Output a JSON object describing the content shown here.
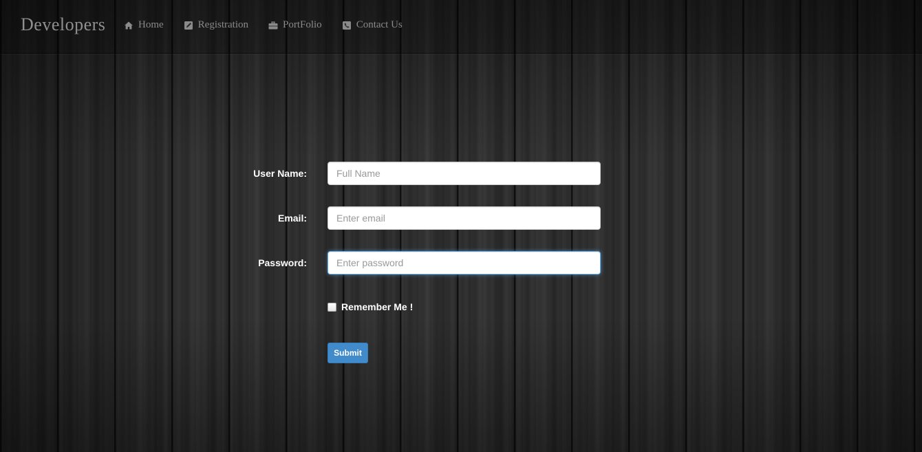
{
  "navbar": {
    "brand": "Developers",
    "items": [
      {
        "label": "Home",
        "icon": "home-icon"
      },
      {
        "label": "Registration",
        "icon": "edit-icon"
      },
      {
        "label": "PortFolio",
        "icon": "briefcase-icon"
      },
      {
        "label": "Contact Us",
        "icon": "phone-icon"
      }
    ]
  },
  "form": {
    "username": {
      "label": "User Name:",
      "placeholder": "Full Name",
      "value": ""
    },
    "email": {
      "label": "Email:",
      "placeholder": "Enter email",
      "value": ""
    },
    "password": {
      "label": "Password:",
      "placeholder": "Enter password",
      "value": "",
      "focused": true
    },
    "remember": {
      "label": "Remember Me !",
      "checked": false
    },
    "submit_label": "Submit"
  },
  "colors": {
    "accent": "#428bca",
    "nav_text": "#8a8a8a",
    "label_text": "#ffffff"
  }
}
